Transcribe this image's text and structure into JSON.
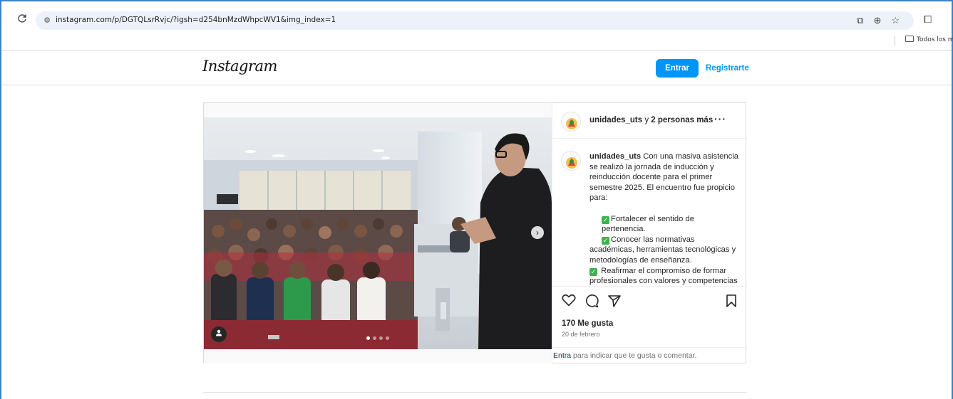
{
  "browser": {
    "url": "instagram.com/p/DGTQLsrRvjc/?igsh=d254bnMzdWhpcWV1&img_index=1",
    "bookmark_folder": "Todos los m"
  },
  "header": {
    "logo": "Instagram",
    "login_label": "Entrar",
    "signup_label": "Registrarte"
  },
  "post": {
    "carousel": {
      "count": 4,
      "active": 0
    },
    "author_line_user": "unidades_uts",
    "author_line_mid": " y ",
    "author_line_others": "2 personas más",
    "more_label": "···",
    "caption": {
      "username": "unidades_uts",
      "intro": " Con una masiva asistencia se realizó la jornada de inducción y reinducción docente para el primer semestre 2025. El encuentro fue propicio para:",
      "item1": "Fortalecer el sentido de pertenencia.",
      "item2": "Conocer las normativas académicas, herramientas tecnológicas y metodologías de enseñanza.",
      "item3": " Reafirmar el compromiso de formar profesionales con valores y competencias para el mundo laboral."
    },
    "likes": "170 Me gusta",
    "date": "20 de febrero",
    "login_hint_link": "Entra",
    "login_hint_rest": " para indicar que te gusta o comentar."
  }
}
